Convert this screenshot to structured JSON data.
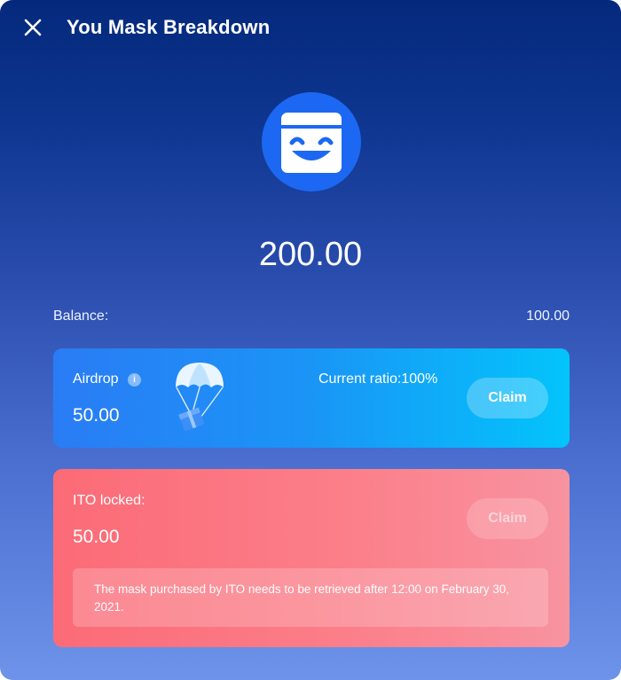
{
  "header": {
    "title": "You Mask Breakdown",
    "close_icon": "close-icon"
  },
  "logo": {
    "icon": "mask-smile-icon",
    "color": "#1c68f3"
  },
  "total": "200.00",
  "balance": {
    "label": "Balance:",
    "value": "100.00"
  },
  "airdrop": {
    "label": "Airdrop",
    "info_icon_glyph": "i",
    "value": "50.00",
    "ratio_text": "Current ratio:100%",
    "claim_label": "Claim",
    "illustration_icon": "parachute-gift-icon"
  },
  "ito": {
    "label": "ITO locked:",
    "value": "50.00",
    "claim_label": "Claim",
    "notice": "The mask purchased by ITO needs to be retrieved after 12:00 on February 30, 2021."
  },
  "colors": {
    "airdrop_start": "#2a7cf5",
    "airdrop_end": "#03c4fb",
    "ito_start": "#fb6b77",
    "ito_end": "#f893a0"
  }
}
